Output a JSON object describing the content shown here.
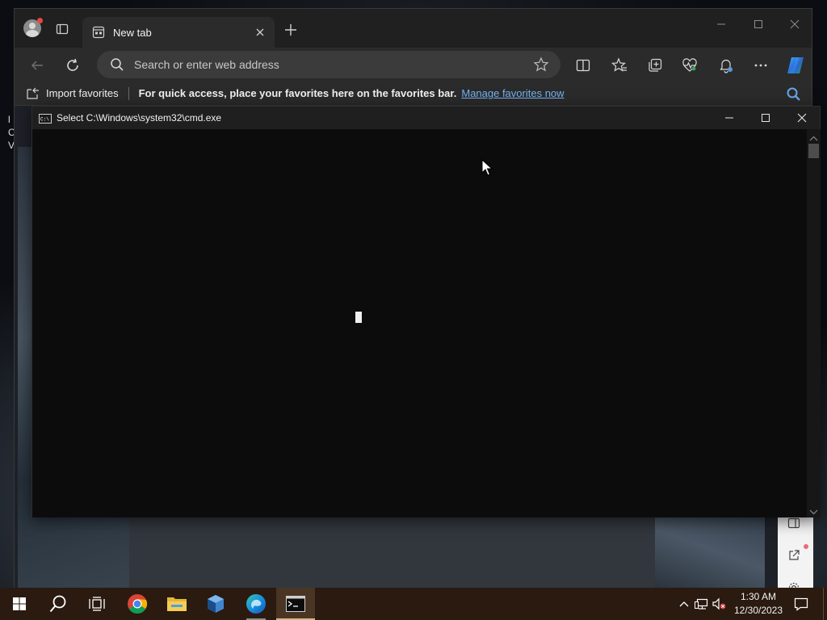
{
  "desktop": {
    "left_text": "l C V"
  },
  "edge": {
    "tab": {
      "title": "New tab"
    },
    "address_bar": {
      "placeholder": "Search or enter web address"
    },
    "favorites_bar": {
      "import_label": "Import favorites",
      "message": "For quick access, place your favorites here on the favorites bar.",
      "manage_link": "Manage favorites now"
    }
  },
  "cmd": {
    "title": "Select C:\\Windows\\system32\\cmd.exe"
  },
  "taskbar": {
    "clock_time": "1:30 AM",
    "clock_date": "12/30/2023",
    "apps": [
      "start",
      "search",
      "task-view",
      "chrome",
      "file-explorer",
      "box-app",
      "edge",
      "cmd"
    ],
    "active_app": "cmd"
  },
  "icons": {
    "profile": "profile-icon",
    "tab_actions": "tab-actions-icon",
    "tab_page": "new-tab-page-icon",
    "back": "back-arrow-icon",
    "refresh": "refresh-icon",
    "search": "search-icon",
    "favorite": "star-icon",
    "split_screen": "split-screen-icon",
    "favorites": "favorites-icon",
    "collections": "collections-icon",
    "health": "browser-essentials-icon",
    "notifications": "bell-icon",
    "more": "more-icon",
    "copilot": "copilot-icon"
  },
  "colors": {
    "edge_chrome": "#202020",
    "edge_toolbar": "#2b2b2b",
    "link": "#74b4f0",
    "cmd_background": "#0c0c0c",
    "taskbar": "#2a1a10"
  }
}
